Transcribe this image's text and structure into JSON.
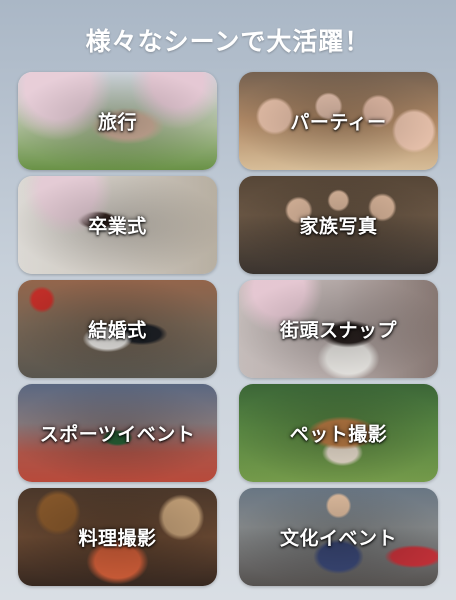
{
  "header": {
    "title": "様々なシーンで大活躍！"
  },
  "cards": [
    {
      "label": "旅行",
      "icon": "travel-photo"
    },
    {
      "label": "パーティー",
      "icon": "party-photo"
    },
    {
      "label": "卒業式",
      "icon": "graduation-photo"
    },
    {
      "label": "家族写真",
      "icon": "family-photo"
    },
    {
      "label": "結婚式",
      "icon": "wedding-photo"
    },
    {
      "label": "街頭スナップ",
      "icon": "street-snap-photo"
    },
    {
      "label": "スポーツイベント",
      "icon": "sports-event-photo"
    },
    {
      "label": "ペット撮影",
      "icon": "pet-photo"
    },
    {
      "label": "料理撮影",
      "icon": "food-photo"
    },
    {
      "label": "文化イベント",
      "icon": "culture-event-photo"
    }
  ],
  "colors": {
    "title_text": "#ffffff",
    "label_text": "#ffffff",
    "background_top": "#aab7c6",
    "background_bottom": "#d9dee4"
  }
}
